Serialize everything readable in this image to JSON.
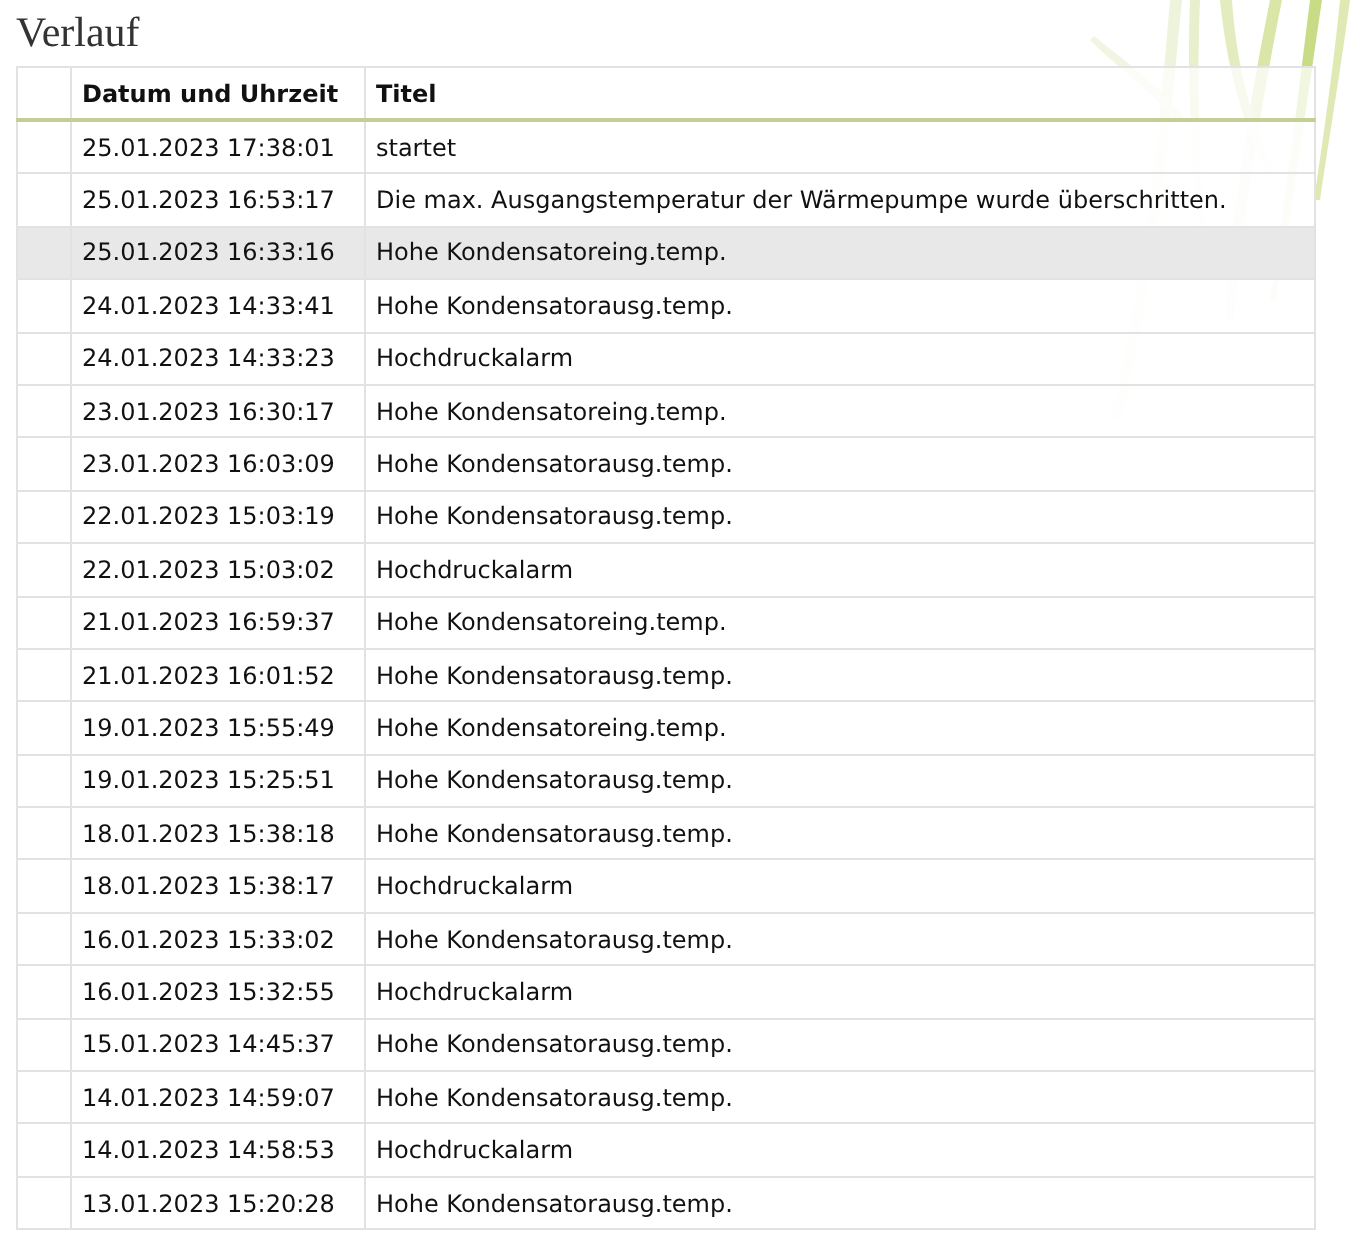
{
  "title": "Verlauf",
  "table": {
    "columns": [
      "Datum und Uhrzeit",
      "Titel"
    ],
    "rows": [
      {
        "date": "25.01.2023 17:38:01",
        "title": "startet",
        "selected": false
      },
      {
        "date": "25.01.2023 16:53:17",
        "title": "Die max. Ausgangstemperatur der Wärmepumpe wurde überschritten.",
        "selected": false
      },
      {
        "date": "25.01.2023 16:33:16",
        "title": "Hohe Kondensatoreing.temp.",
        "selected": true
      },
      {
        "date": "24.01.2023 14:33:41",
        "title": "Hohe Kondensatorausg.temp.",
        "selected": false
      },
      {
        "date": "24.01.2023 14:33:23",
        "title": "Hochdruckalarm",
        "selected": false
      },
      {
        "date": "23.01.2023 16:30:17",
        "title": "Hohe Kondensatoreing.temp.",
        "selected": false
      },
      {
        "date": "23.01.2023 16:03:09",
        "title": "Hohe Kondensatorausg.temp.",
        "selected": false
      },
      {
        "date": "22.01.2023 15:03:19",
        "title": "Hohe Kondensatorausg.temp.",
        "selected": false
      },
      {
        "date": "22.01.2023 15:03:02",
        "title": "Hochdruckalarm",
        "selected": false
      },
      {
        "date": "21.01.2023 16:59:37",
        "title": "Hohe Kondensatoreing.temp.",
        "selected": false
      },
      {
        "date": "21.01.2023 16:01:52",
        "title": "Hohe Kondensatorausg.temp.",
        "selected": false
      },
      {
        "date": "19.01.2023 15:55:49",
        "title": "Hohe Kondensatoreing.temp.",
        "selected": false
      },
      {
        "date": "19.01.2023 15:25:51",
        "title": "Hohe Kondensatorausg.temp.",
        "selected": false
      },
      {
        "date": "18.01.2023 15:38:18",
        "title": "Hohe Kondensatorausg.temp.",
        "selected": false
      },
      {
        "date": "18.01.2023 15:38:17",
        "title": "Hochdruckalarm",
        "selected": false
      },
      {
        "date": "16.01.2023 15:33:02",
        "title": "Hohe Kondensatorausg.temp.",
        "selected": false
      },
      {
        "date": "16.01.2023 15:32:55",
        "title": "Hochdruckalarm",
        "selected": false
      },
      {
        "date": "15.01.2023 14:45:37",
        "title": "Hohe Kondensatorausg.temp.",
        "selected": false
      },
      {
        "date": "14.01.2023 14:59:07",
        "title": "Hohe Kondensatorausg.temp.",
        "selected": false
      },
      {
        "date": "14.01.2023 14:58:53",
        "title": "Hochdruckalarm",
        "selected": false
      },
      {
        "date": "13.01.2023 15:20:28",
        "title": "Hohe Kondensatorausg.temp.",
        "selected": false
      }
    ]
  }
}
